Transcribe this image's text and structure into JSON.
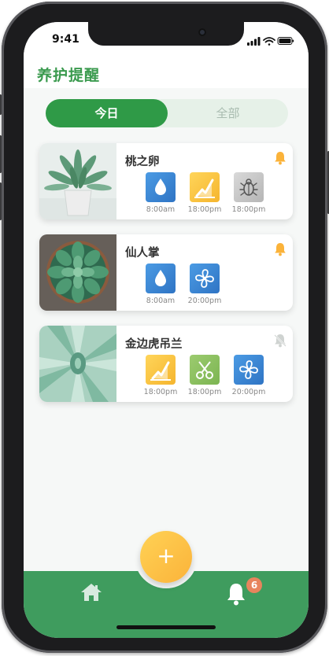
{
  "status": {
    "time": "9:41"
  },
  "header": {
    "title": "养护提醒"
  },
  "tabs": [
    {
      "label": "今日",
      "active": true
    },
    {
      "label": "全部",
      "active": false
    }
  ],
  "plants": [
    {
      "name": "桃之卵",
      "bell_enabled": true,
      "tasks": [
        {
          "icon": "water-drop-icon",
          "time": "8:00am",
          "color": "#3a86d4"
        },
        {
          "icon": "fertilize-icon",
          "time": "18:00pm",
          "color": "#f8c437"
        },
        {
          "icon": "bug-icon",
          "time": "18:00pm",
          "color": "#bdbdbd"
        }
      ]
    },
    {
      "name": "仙人掌",
      "bell_enabled": true,
      "tasks": [
        {
          "icon": "water-drop-icon",
          "time": "8:00am",
          "color": "#3a86d4"
        },
        {
          "icon": "fan-icon",
          "time": "20:00pm",
          "color": "#3a86d4"
        }
      ]
    },
    {
      "name": "金边虎吊兰",
      "bell_enabled": false,
      "tasks": [
        {
          "icon": "fertilize-icon",
          "time": "18:00pm",
          "color": "#f8c437"
        },
        {
          "icon": "scissors-icon",
          "time": "18:00pm",
          "color": "#8cc063"
        },
        {
          "icon": "fan-icon",
          "time": "20:00pm",
          "color": "#3a86d4"
        }
      ]
    }
  ],
  "nav": {
    "badge_count": "6",
    "fab_label": "+"
  },
  "colors": {
    "brand_green": "#2f9a47",
    "nav_green": "#3f9c5e",
    "accent_yellow": "#fbb33a",
    "badge_orange": "#e8845d"
  }
}
